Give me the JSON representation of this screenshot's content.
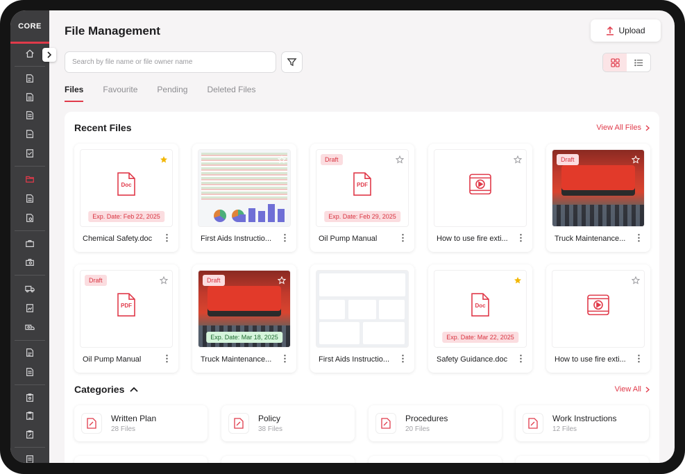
{
  "app": {
    "logo": "CORE"
  },
  "header": {
    "title": "File Management",
    "upload_label": "Upload"
  },
  "search": {
    "placeholder": "Search by file name or file owner name",
    "value": ""
  },
  "tabs": [
    {
      "label": "Files",
      "active": true
    },
    {
      "label": "Favourite",
      "active": false
    },
    {
      "label": "Pending",
      "active": false
    },
    {
      "label": "Deleted Files",
      "active": false
    }
  ],
  "recent": {
    "title": "Recent Files",
    "view_all": "View All Files",
    "files": [
      {
        "name": "Chemical Safety.doc",
        "kind": "doc",
        "icon_label": "Doc",
        "badge": "",
        "exp": "Exp. Date: Feb 22, 2025",
        "exp_style": "red",
        "favourite": true
      },
      {
        "name": "First Aids Instructio...",
        "kind": "sheet",
        "icon_label": "",
        "badge": "",
        "exp": "",
        "exp_style": "",
        "favourite": false
      },
      {
        "name": "Oil Pump Manual",
        "kind": "pdf",
        "icon_label": "PDF",
        "badge": "Draft",
        "exp": "Exp. Date: Feb 29, 2025",
        "exp_style": "red",
        "favourite": false
      },
      {
        "name": "How to use fire exti...",
        "kind": "video",
        "icon_label": "",
        "badge": "",
        "exp": "",
        "exp_style": "",
        "favourite": false
      },
      {
        "name": "Truck Maintenance...",
        "kind": "photo",
        "icon_label": "",
        "badge": "Draft",
        "exp": "",
        "exp_style": "",
        "favourite": false
      },
      {
        "name": "Oil Pump Manual",
        "kind": "pdf",
        "icon_label": "PDF",
        "badge": "Draft",
        "exp": "",
        "exp_style": "",
        "favourite": false
      },
      {
        "name": "Truck Maintenance...",
        "kind": "photo",
        "icon_label": "",
        "badge": "Draft",
        "exp": "Exp. Date: Mar 18, 2025",
        "exp_style": "green",
        "favourite": false
      },
      {
        "name": "First Aids Instructio...",
        "kind": "dashboard",
        "icon_label": "",
        "badge": "",
        "exp": "",
        "exp_style": "",
        "favourite": false
      },
      {
        "name": "Safety Guidance.doc",
        "kind": "doc",
        "icon_label": "Doc",
        "badge": "",
        "exp": "Exp. Date: Mar 22, 2025",
        "exp_style": "red",
        "favourite": true
      },
      {
        "name": "How to use fire exti...",
        "kind": "video",
        "icon_label": "",
        "badge": "",
        "exp": "",
        "exp_style": "",
        "favourite": false
      }
    ]
  },
  "categories": {
    "title": "Categories",
    "view_all": "View All",
    "items": [
      {
        "name": "Written Plan",
        "count": "28 Files"
      },
      {
        "name": "Policy",
        "count": "38 Files"
      },
      {
        "name": "Procedures",
        "count": "20 Files"
      },
      {
        "name": "Work Instructions",
        "count": "12 Files"
      }
    ]
  },
  "colors": {
    "accent": "#e03a4a",
    "sidebar": "#3d3d3f",
    "favourite": "#f2b705"
  }
}
